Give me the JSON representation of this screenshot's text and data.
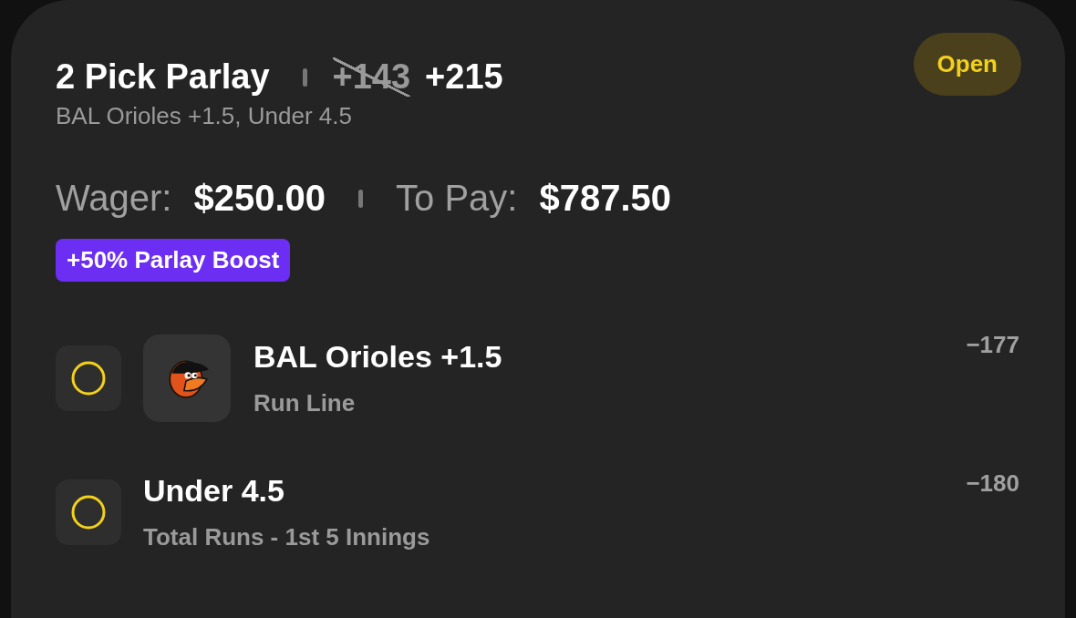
{
  "bet": {
    "title": "2 Pick Parlay",
    "old_odds": "+143",
    "odds": "+215",
    "summary": "BAL Orioles +1.5, Under 4.5",
    "status": "Open"
  },
  "amounts": [
    {
      "label": "Wager:",
      "value": "$250.00"
    },
    {
      "label": "To Pay:",
      "value": "$787.50"
    }
  ],
  "boost": "+50% Parlay Boost",
  "legs": [
    {
      "kind": "team",
      "title": "BAL Orioles +1.5",
      "market": "Run Line",
      "odds": "−177"
    },
    {
      "kind": "total",
      "title": "Under 4.5",
      "market": "Total Runs - 1st 5 Innings",
      "odds": "−180"
    }
  ]
}
